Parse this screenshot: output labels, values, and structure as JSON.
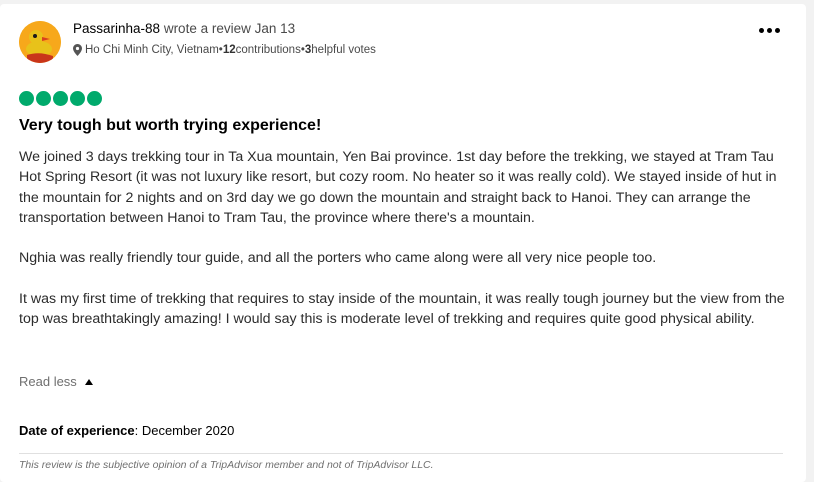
{
  "review": {
    "username": "Passarinha-88",
    "wrote_text": " wrote a review Jan 13",
    "location": "Ho Chi Minh City, Vietnam",
    "sep1": " • ",
    "contributions_count": "12",
    "contributions_label": " contributions",
    "sep2": " • ",
    "helpful_count": "3",
    "helpful_label": " helpful votes",
    "rating": 5,
    "rating_max": 5,
    "title": "Very tough but worth trying experience!",
    "paragraphs": [
      "We joined 3 days trekking tour in Ta Xua mountain, Yen Bai province. 1st day before the trekking, we stayed at Tram Tau Hot Spring Resort (it was not luxury like resort, but cozy room. No heater so it was really cold). We stayed inside of hut in the mountain for 2 nights and on 3rd day we go down the mountain and straight back to Hanoi. They can arrange the transportation between Hanoi to Tram Tau, the province where there's a mountain.",
      "Nghia was really friendly tour guide, and all the porters who came along were all very nice people too.",
      "It was my first time of trekking that requires to stay inside of the mountain, it was really tough journey but the view from the top was breathtakingly amazing! I would say this is moderate level of trekking and requires quite good physical ability."
    ],
    "read_less": "Read less",
    "date_label": "Date of experience",
    "date_value": ": December 2020",
    "disclaimer": "This review is the subjective opinion of a TripAdvisor member and not of TripAdvisor LLC."
  },
  "icons": {
    "avatar": "duck-avatar",
    "location": "map-pin-icon",
    "menu": "more-dots-icon",
    "read_less": "caret-up-icon"
  },
  "colors": {
    "rating_bubble": "#00aa6c",
    "avatar_bg": "#f7a81b"
  }
}
